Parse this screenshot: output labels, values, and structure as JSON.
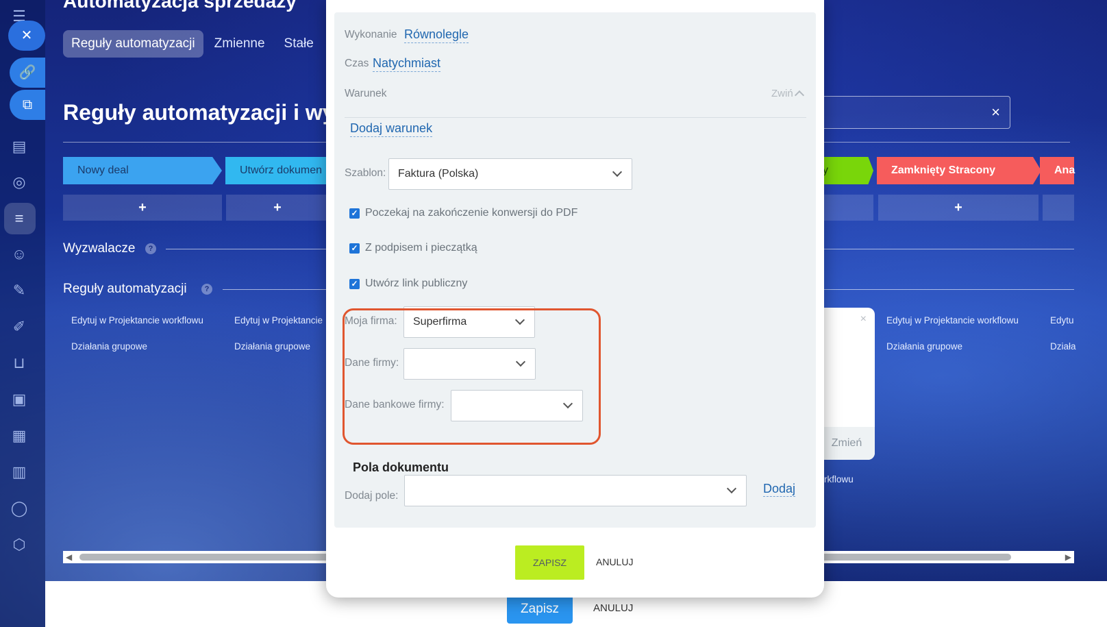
{
  "header": {
    "title": "Automatyzacja sprzedaży",
    "tabs": [
      "Reguły automatyzacji",
      "Zmienne",
      "Stałe"
    ]
  },
  "rail": {
    "icons": [
      "menu-icon",
      "close-icon",
      "link-icon",
      "external-link-icon",
      "contact-card-icon",
      "target-icon",
      "funnel-icon",
      "robot-icon",
      "pen-icon",
      "document-edit-icon",
      "cart-icon",
      "store-icon",
      "calendar-icon",
      "chart-icon",
      "circle-icon",
      "cube-icon"
    ]
  },
  "page": {
    "title": "Reguły automatyzacji i wyz",
    "stages": [
      "Nowy deal",
      "Utwórz dokumen",
      "y",
      "Zamknięty Stracony",
      "Ana"
    ],
    "plus": "+",
    "wyzwalacze": "Wyzwalacze",
    "reguly": "Reguły automatyzacji",
    "help": "?",
    "edit_link": "Edytuj w Projektancie workflowu",
    "edit_link_short": "Edytuj w Projektancie",
    "edit_link_tiny": "Edytu",
    "group_link": "Działania grupowe",
    "group_link_short": "Działa",
    "workflow_tail": "rkflowu",
    "change": "Zmień",
    "close_x": "×"
  },
  "bottom": {
    "save": "Zapisz",
    "cancel": "ANULUJ"
  },
  "modal": {
    "wykonanie_label": "Wykonanie",
    "wykonanie_value": "Równolegle",
    "czas_label": "Czas",
    "czas_value": "Natychmiast",
    "warunek_label": "Warunek",
    "zwin": "Zwiń",
    "dodaj_warunek": "Dodaj warunek",
    "szablon_label": "Szablon:",
    "szablon_value": "Faktura (Polska)",
    "checks": [
      "Poczekaj na zakończenie konwersji do PDF",
      "Z podpisem i pieczątką",
      "Utwórz link publiczny"
    ],
    "moja_firma_label": "Moja firma:",
    "moja_firma_value": "Superfirma",
    "dane_firmy_label": "Dane firmy:",
    "dane_firmy_value": "",
    "dane_bankowe_label": "Dane bankowe firmy:",
    "dane_bankowe_value": "",
    "pola_title": "Pola dokumentu",
    "dodaj_pole_label": "Dodaj pole:",
    "dodaj_pole_value": "",
    "dodaj": "Dodaj",
    "save": "ZAPISZ",
    "cancel": "ANULUJ"
  }
}
